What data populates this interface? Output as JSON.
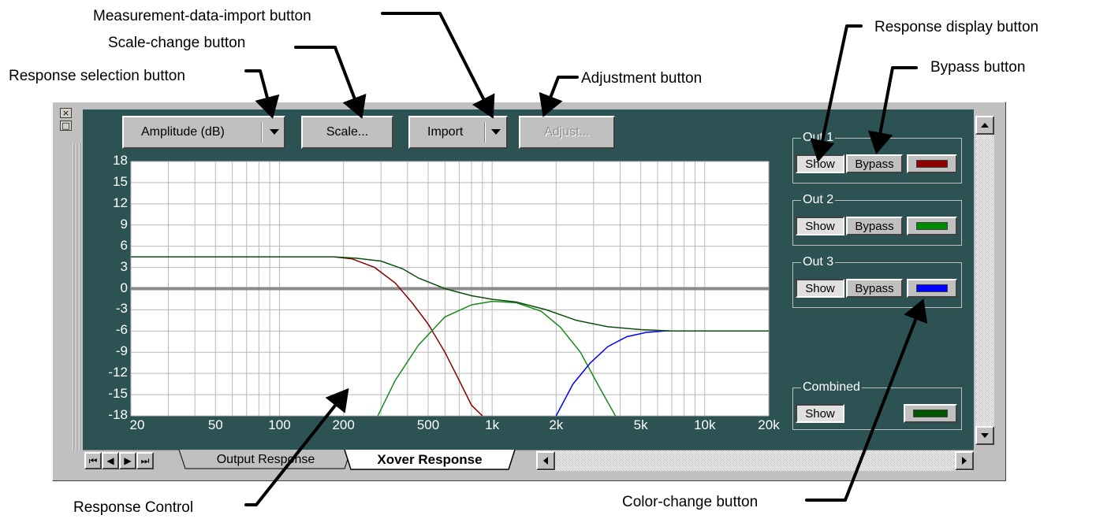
{
  "callouts": {
    "measurement_import": "Measurement-data-import button",
    "scale_change": "Scale-change button",
    "response_selection": "Response selection button",
    "adjustment": "Adjustment button",
    "response_display": "Response display button",
    "bypass": "Bypass button",
    "response_control": "Response Control",
    "color_change": "Color-change button"
  },
  "toolbar": {
    "amplitude_label": "Amplitude (dB)",
    "scale_label": "Scale...",
    "import_label": "Import",
    "adjust_label": "Adjust..."
  },
  "window_controls": {
    "close_glyph": "×",
    "restore_glyph": "□"
  },
  "outputs": [
    {
      "title": "Out 1",
      "show_label": "Show",
      "bypass_label": "Bypass",
      "color": "#8b0000"
    },
    {
      "title": "Out 2",
      "show_label": "Show",
      "bypass_label": "Bypass",
      "color": "#008c00"
    },
    {
      "title": "Out 3",
      "show_label": "Show",
      "bypass_label": "Bypass",
      "color": "#0000ff"
    }
  ],
  "combined": {
    "title": "Combined",
    "show_label": "Show",
    "color": "#005400"
  },
  "tabs": {
    "nav": [
      "⏮",
      "◀",
      "▶",
      "⏭"
    ],
    "output_response": "Output Response",
    "xover_response": "Xover Response"
  },
  "chart_data": {
    "type": "line",
    "x_scale": "log",
    "xlim": [
      20,
      20000
    ],
    "ylim": [
      -18,
      18
    ],
    "y_ticks": [
      18,
      15,
      12,
      9,
      6,
      3,
      0,
      -3,
      -6,
      -9,
      -12,
      -15,
      -18
    ],
    "y_tick_labels": [
      "18",
      "15",
      "12",
      "9",
      "6",
      "3",
      "0",
      "-3",
      "-6",
      "-9",
      "-12",
      "-15",
      "-18"
    ],
    "x_ticks": [
      20,
      50,
      100,
      200,
      500,
      1000,
      2000,
      5000,
      10000,
      20000
    ],
    "x_tick_labels": [
      "20",
      "50",
      "100",
      "200",
      "500",
      "1k",
      "2k",
      "5k",
      "10k",
      "20k"
    ],
    "grid": true,
    "series": [
      {
        "color": "#8b0000",
        "x": [
          180,
          220,
          280,
          350,
          420,
          500,
          600,
          700,
          800,
          900
        ],
        "y": [
          4.5,
          4.2,
          3.0,
          0.8,
          -2,
          -5,
          -9,
          -13,
          -16.5,
          -18
        ]
      },
      {
        "color": "#1a8a1a",
        "x": [
          290,
          350,
          450,
          600,
          800,
          1000,
          1300,
          1700,
          2100,
          2600,
          3200,
          3800
        ],
        "y": [
          -18,
          -13,
          -8,
          -4,
          -2.3,
          -1.8,
          -2.0,
          -3.2,
          -5.5,
          -9,
          -14,
          -18
        ]
      },
      {
        "color": "#0000ff",
        "x": [
          2000,
          2400,
          2900,
          3500,
          4300,
          5300,
          6500,
          8000,
          9000
        ],
        "y": [
          -18,
          -13.5,
          -10.5,
          -8.2,
          -6.8,
          -6.2,
          -6.0,
          -6.0,
          -6.0
        ]
      },
      {
        "color": "#0d4d0d",
        "x": [
          20,
          50,
          100,
          180,
          230,
          300,
          380,
          450,
          600,
          800,
          1000,
          1300,
          1800,
          2500,
          3500,
          5000,
          7000,
          10000,
          20000
        ],
        "y": [
          4.5,
          4.5,
          4.5,
          4.5,
          4.3,
          3.9,
          2.8,
          1.5,
          0,
          -1.0,
          -1.5,
          -1.9,
          -3.0,
          -4.5,
          -5.4,
          -5.8,
          -6.0,
          -6.0,
          -6.0
        ]
      }
    ]
  }
}
